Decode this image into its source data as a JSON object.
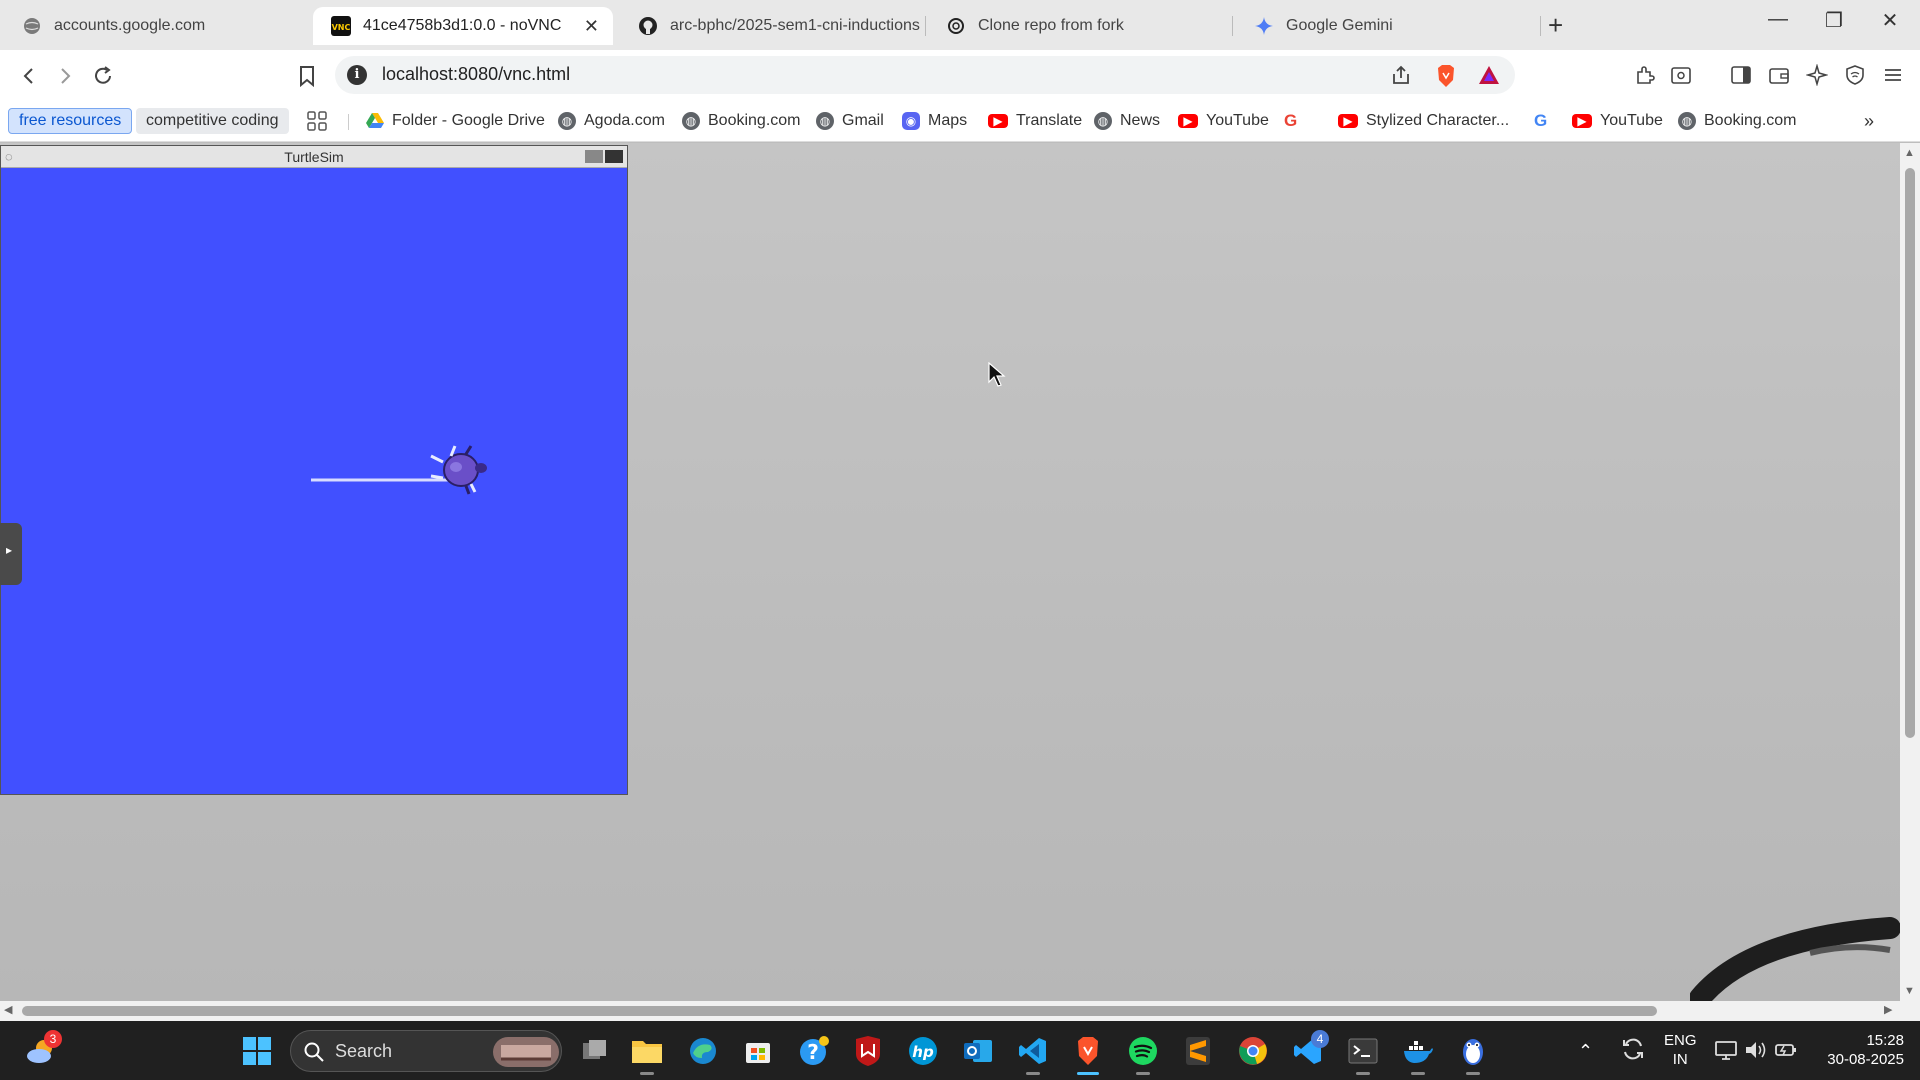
{
  "tabs": [
    {
      "title": "accounts.google.com",
      "icon": "globe-icon"
    },
    {
      "title": "41ce4758b3d1:0.0 - noVNC",
      "icon": "novnc-icon",
      "close": "✕"
    },
    {
      "title": "arc-bphc/2025-sem1-cni-inductions",
      "icon": "github-icon"
    },
    {
      "title": "Clone repo from fork",
      "icon": "openai-icon"
    },
    {
      "title": "Google Gemini",
      "icon": "gemini-icon"
    }
  ],
  "address": {
    "url": "localhost:8080/vnc.html"
  },
  "bookmarks": [
    {
      "label": "free resources"
    },
    {
      "label": "competitive coding"
    },
    {
      "label": "Folder - Google Drive"
    },
    {
      "label": "Agoda.com"
    },
    {
      "label": "Booking.com"
    },
    {
      "label": "Gmail"
    },
    {
      "label": "Maps"
    },
    {
      "label": "Translate"
    },
    {
      "label": "News"
    },
    {
      "label": "YouTube"
    },
    {
      "label": "Stylized Character..."
    },
    {
      "label": "YouTube"
    },
    {
      "label": "Booking.com"
    }
  ],
  "vnc": {
    "window_title": "TurtleSim"
  },
  "taskbar": {
    "search_label": "Search",
    "weather_badge": "3",
    "vscode_badge": "4",
    "lang_line1": "ENG",
    "lang_line2": "IN",
    "time": "15:28",
    "date": "30-08-2025"
  },
  "colors": {
    "turtle_background": "#4150ff"
  }
}
